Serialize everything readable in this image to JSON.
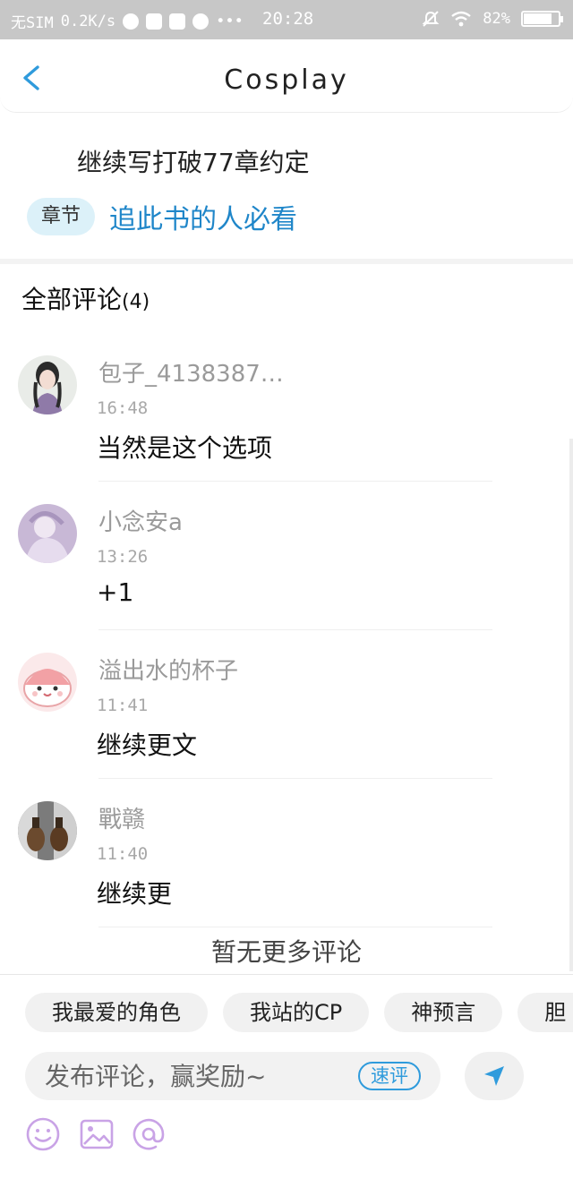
{
  "status_bar": {
    "carrier": "无SIM",
    "speed": "0.2K/s",
    "dots": "•••",
    "time": "20:28",
    "battery": "82%",
    "battery_level": 0.82
  },
  "header": {
    "title": "Cosplay"
  },
  "chapter": {
    "topic": "继续写打破77章约定",
    "tag": "章节",
    "link": "追此书的人必看"
  },
  "comments_section": {
    "title": "全部评论",
    "count": "(4)",
    "items": [
      {
        "name": "包子_4138387…",
        "time": "16:48",
        "text": "当然是这个选项",
        "avatar": "portrait-avatar"
      },
      {
        "name": "小念安a",
        "time": "13:26",
        "text": "+1",
        "avatar": "lavender-avatar"
      },
      {
        "name": "溢出水的杯子",
        "time": "11:41",
        "text": "继续更文",
        "avatar": "pink-mascot-avatar"
      },
      {
        "name": "戰赣",
        "time": "11:40",
        "text": "继续更",
        "avatar": "photo-avatar"
      }
    ],
    "no_more": "暂无更多评论"
  },
  "composer": {
    "chips": [
      "我最爱的角色",
      "我站的CP",
      "神预言",
      "胆"
    ],
    "placeholder": "发布评论，赢奖励~",
    "quick_label": "速评",
    "accent": "#2f9bdc",
    "tool_color": "#c9a3e6"
  }
}
